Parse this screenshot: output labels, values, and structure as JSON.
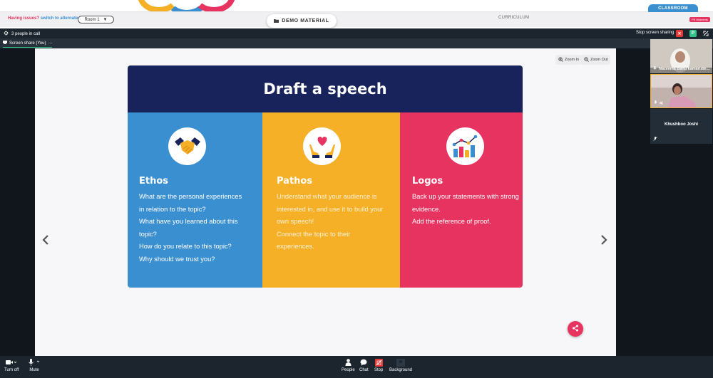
{
  "header": {
    "issues_text": "Having issues?",
    "alternate_room_link": "switch to alternate room",
    "room_selector": "Room 1",
    "room_caret": "▼",
    "demo_material_label": "DEMO MATERIAL",
    "curriculum_label": "CURRICULUM",
    "classroom_tab": "CLASSROOM",
    "badge": "PS Moments"
  },
  "call": {
    "people_count_label": "3 people in call",
    "stop_sharing_label": "Stop screen sharing",
    "share_tab_label": "Screen share (You)",
    "share_tab_more": "···",
    "p_button": "P"
  },
  "viewer": {
    "zoom_in": "Zoom In",
    "zoom_out": "Zoom Out",
    "prev_arrow": "‹",
    "next_arrow": "›"
  },
  "slide": {
    "title": "Draft a speech",
    "columns": [
      {
        "heading": "Ethos",
        "icon": "handshake-icon",
        "color": "#3a8fd0",
        "lines": [
          "What are the personal experiences",
          "in relation to the topic?",
          "What have you learned about this",
          "topic?",
          "How do you relate to this topic?",
          "Why should we trust you?"
        ]
      },
      {
        "heading": "Pathos",
        "icon": "heart-hands-icon",
        "color": "#f5b027",
        "lines": [
          "Understand what your audience is",
          "interested in, and use it to build your",
          "own speech!",
          "Connect the topic to their",
          "experiences."
        ]
      },
      {
        "heading": "Logos",
        "icon": "bar-chart-icon",
        "color": "#e73360",
        "lines": [
          "Back up your statements with strong",
          "evidence.",
          "Add the reference of proof."
        ]
      }
    ]
  },
  "participants": [
    {
      "name": "Nazeema Banu kamarude..."
    },
    {
      "name": "aj"
    },
    {
      "name": "Khushboo Joshi"
    }
  ],
  "toolbar": {
    "turn_off": "Turn off",
    "mute": "Mute",
    "people": "People",
    "chat": "Chat",
    "stop": "Stop",
    "background": "Background"
  },
  "colors": {
    "navy": "#17235a",
    "blue": "#3a8fd0",
    "yellow": "#f5b027",
    "pink": "#e73360",
    "dark": "#1c252e"
  }
}
